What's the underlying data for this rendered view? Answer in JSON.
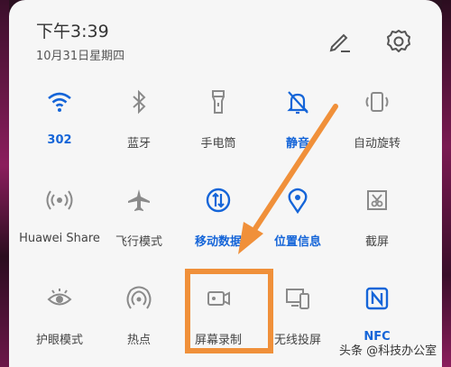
{
  "status": {
    "time": "下午3:39",
    "date": "10月31日星期四"
  },
  "header_icons": [
    "edit-icon",
    "gear-icon"
  ],
  "tiles": [
    {
      "label": "302",
      "icon": "wifi-icon",
      "active": true
    },
    {
      "label": "蓝牙",
      "icon": "bluetooth-icon",
      "active": false
    },
    {
      "label": "手电筒",
      "icon": "flashlight-icon",
      "active": false
    },
    {
      "label": "静音",
      "icon": "bell-off-icon",
      "active": true
    },
    {
      "label": "自动旋转",
      "icon": "rotate-icon",
      "active": false
    },
    {
      "label": "Huawei Share",
      "icon": "share-icon",
      "active": false
    },
    {
      "label": "飞行模式",
      "icon": "airplane-icon",
      "active": false
    },
    {
      "label": "移动数据",
      "icon": "mobile-data-icon",
      "active": true
    },
    {
      "label": "位置信息",
      "icon": "location-icon",
      "active": true
    },
    {
      "label": "截屏",
      "icon": "screenshot-icon",
      "active": false
    },
    {
      "label": "护眼模式",
      "icon": "eye-icon",
      "active": false
    },
    {
      "label": "热点",
      "icon": "hotspot-icon",
      "active": false
    },
    {
      "label": "屏幕录制",
      "icon": "screen-record-icon",
      "active": false
    },
    {
      "label": "无线投屏",
      "icon": "wireless-projection-icon",
      "active": false
    },
    {
      "label": "NFC",
      "icon": "nfc-icon",
      "active": true
    }
  ],
  "watermark": "头条 @科技办公室",
  "colors": {
    "active": "#1565d8",
    "inactive": "#8a8a8a",
    "highlight": "#f0903a"
  }
}
